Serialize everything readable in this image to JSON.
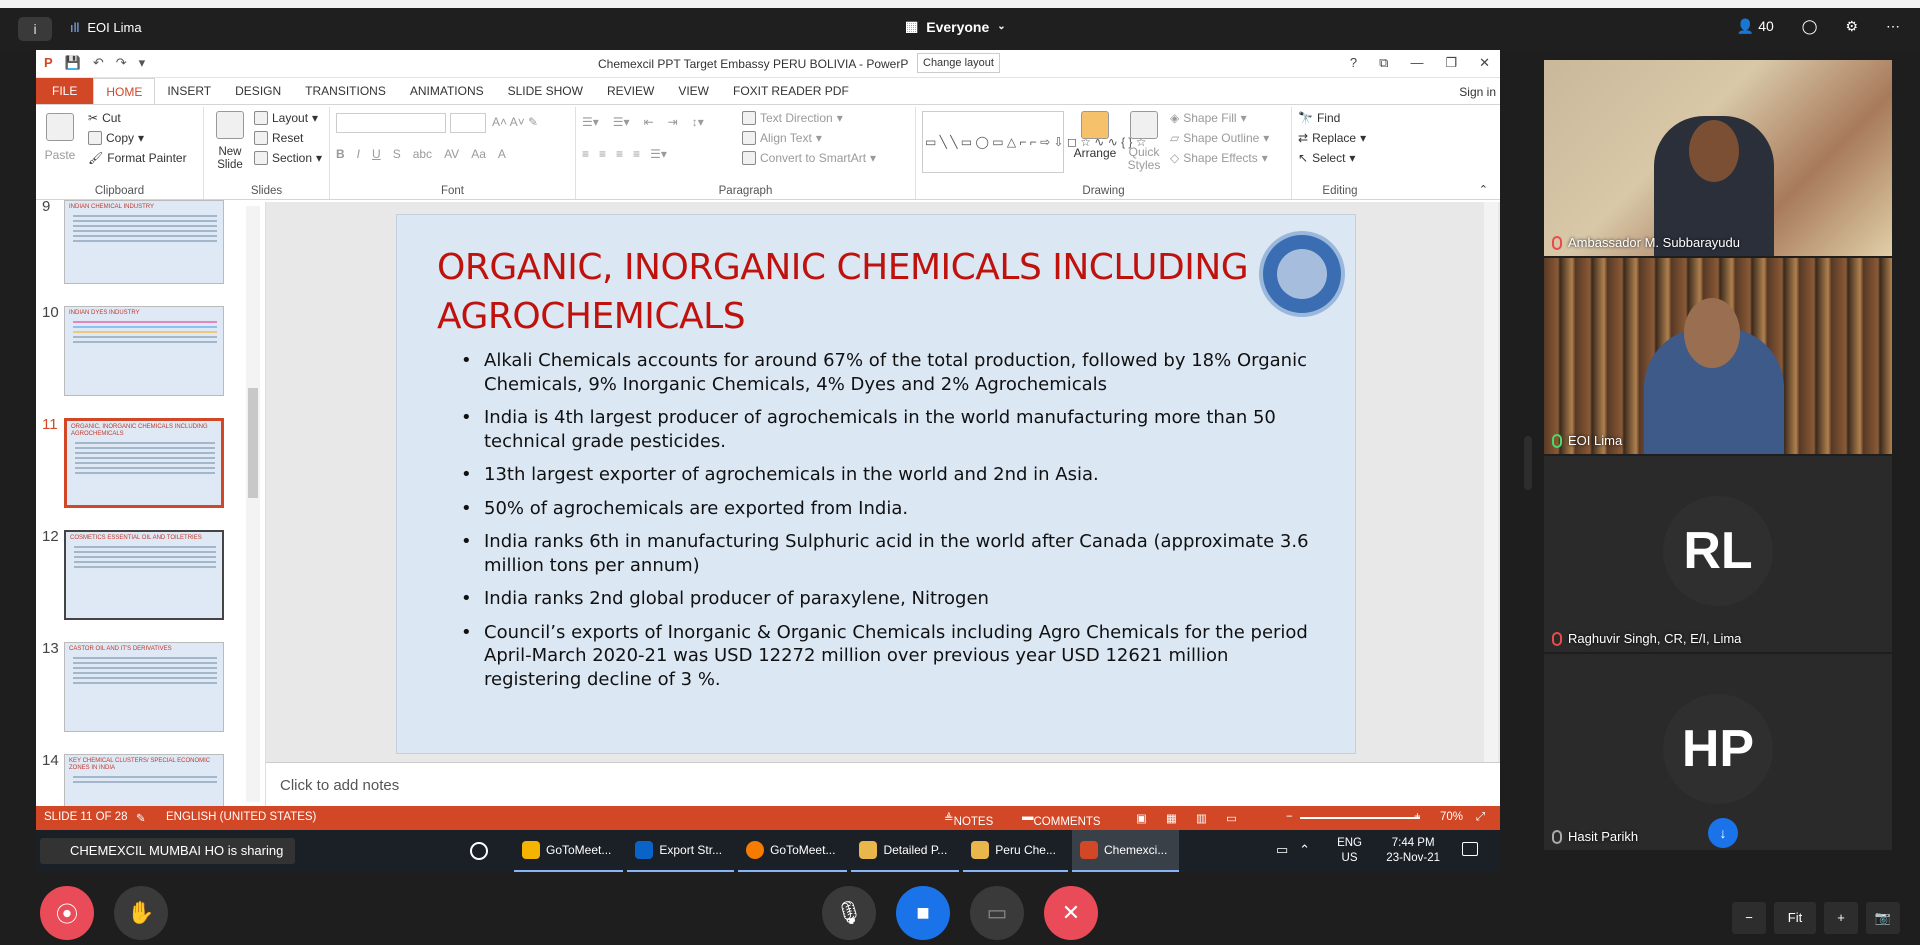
{
  "meeting": {
    "name": "EOI Lima",
    "view": "Everyone",
    "participant_count": "40"
  },
  "ppt": {
    "window_title": "Chemexcil PPT Target Embassy PERU  BOLIVIA - PowerP",
    "tooltip": "Change layout",
    "sign_in": "Sign in",
    "tabs": [
      "FILE",
      "HOME",
      "INSERT",
      "DESIGN",
      "TRANSITIONS",
      "ANIMATIONS",
      "SLIDE SHOW",
      "REVIEW",
      "VIEW",
      "FOXIT READER PDF"
    ],
    "ribbon": {
      "clipboard": {
        "name": "Clipboard",
        "paste": "Paste",
        "cut": "Cut",
        "copy": "Copy",
        "format_painter": "Format Painter"
      },
      "slides": {
        "name": "Slides",
        "new_slide": "New Slide",
        "layout": "Layout",
        "reset": "Reset",
        "section": "Section"
      },
      "font": {
        "name": "Font"
      },
      "paragraph": {
        "name": "Paragraph",
        "text_direction": "Text Direction",
        "align_text": "Align Text",
        "convert_smartart": "Convert to SmartArt"
      },
      "drawing": {
        "name": "Drawing",
        "arrange": "Arrange",
        "quick_styles": "Quick Styles",
        "shape_fill": "Shape Fill",
        "shape_outline": "Shape Outline",
        "shape_effects": "Shape Effects"
      },
      "editing": {
        "name": "Editing",
        "find": "Find",
        "replace": "Replace",
        "select": "Select"
      }
    },
    "thumbnails": [
      {
        "num": "9",
        "title": "INDIAN CHEMICAL INDUSTRY",
        "selected": false
      },
      {
        "num": "10",
        "title": "INDIAN DYES INDUSTRY",
        "selected": false
      },
      {
        "num": "11",
        "title": "ORGANIC, INORGANIC CHEMICALS INCLUDING AGROCHEMICALS",
        "selected": true
      },
      {
        "num": "12",
        "title": "COSMETICS ESSENTIAL OIL AND TOILETRIES",
        "selected": false
      },
      {
        "num": "13",
        "title": "CASTOR OIL AND IT'S DERIVATIVES",
        "selected": false
      },
      {
        "num": "14",
        "title": "KEY CHEMICAL CLUSTERS/ SPECIAL ECONOMIC ZONES IN INDIA",
        "selected": false
      }
    ],
    "slide": {
      "title": "ORGANIC, INORGANIC CHEMICALS INCLUDING AGROCHEMICALS",
      "bullets": [
        "Alkali Chemicals accounts for around 67% of the total production, followed by 18% Organic Chemicals, 9% Inorganic Chemicals, 4% Dyes and 2% Agrochemicals",
        "India is 4th largest producer of agrochemicals in the world manufacturing more than 50 technical grade pesticides.",
        "13th largest exporter of agrochemicals in the world and 2nd in Asia.",
        "50% of agrochemicals are exported from India.",
        "India ranks 6th  in manufacturing Sulphuric acid in the world after Canada  (approximate 3.6 million tons per annum)",
        "India ranks 2nd global producer of paraxylene, Nitrogen",
        "Council’s exports of Inorganic & Organic Chemicals including Agro Chemicals for the period April-March 2020-21 was USD 12272 million over previous year USD 12621 million registering decline of 3 %."
      ]
    },
    "notes_placeholder": "Click to add notes",
    "status": {
      "slide": "SLIDE 11 OF 28",
      "language": "ENGLISH (UNITED STATES)",
      "notes": "NOTES",
      "comments": "COMMENTS",
      "zoom": "70%"
    }
  },
  "taskbar": {
    "sharing": "CHEMEXCIL MUMBAI HO is sharing",
    "apps": [
      {
        "label": "GoToMeet...",
        "color": "#f4b400"
      },
      {
        "label": "Export Str...",
        "color": "#0a64c8"
      },
      {
        "label": "GoToMeet...",
        "color": "#f57c00"
      },
      {
        "label": "Detailed P...",
        "color": "#e8b64a"
      },
      {
        "label": "Peru Che...",
        "color": "#e8b64a"
      },
      {
        "label": "Chemexci...",
        "color": "#d24726"
      }
    ],
    "lang": "ENG",
    "region": "US",
    "time": "7:44 PM",
    "date": "23-Nov-21"
  },
  "participants": [
    {
      "name": "Ambassador M. Subbarayudu",
      "mic": "off"
    },
    {
      "name": "EOI Lima",
      "mic": "on"
    },
    {
      "name": "Raghuvir Singh, CR, E/I, Lima",
      "initials": "RL",
      "mic": "off"
    },
    {
      "name": "Hasit Parikh",
      "initials": "HP",
      "mic": "gray"
    }
  ],
  "controls": {
    "fit": "Fit",
    "minus": "−",
    "plus": "+"
  }
}
